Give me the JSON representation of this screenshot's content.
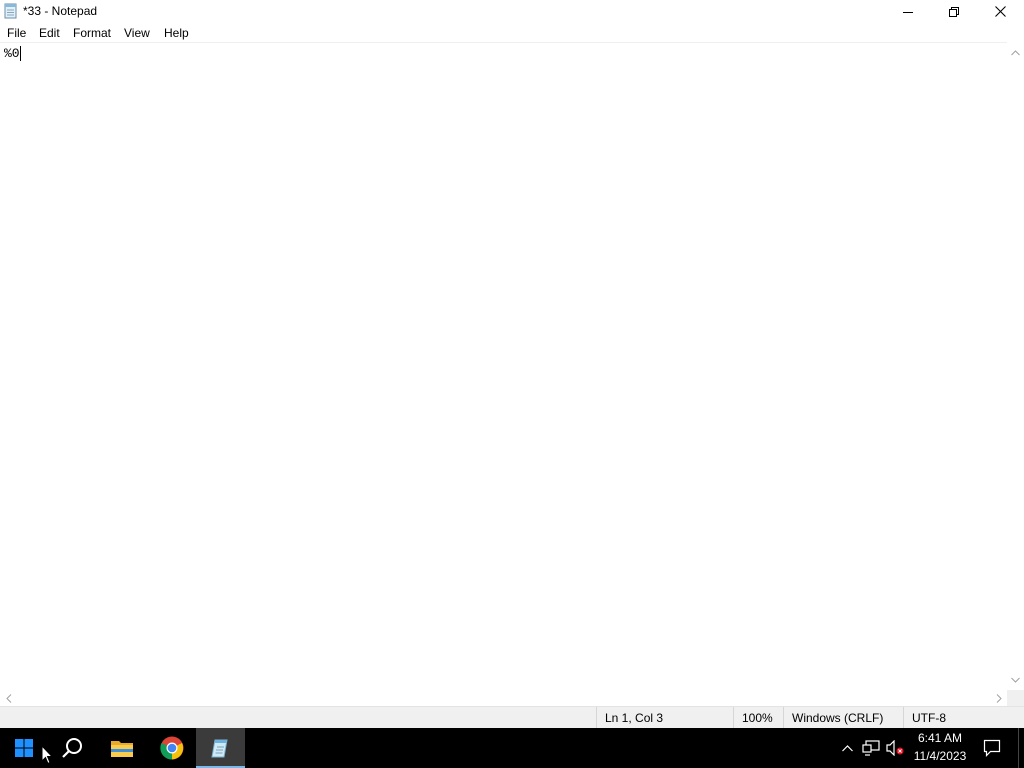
{
  "window": {
    "title": "*33 - Notepad",
    "icon": "notepad-icon"
  },
  "menu": {
    "file": "File",
    "edit": "Edit",
    "format": "Format",
    "view": "View",
    "help": "Help"
  },
  "editor": {
    "content": "%0"
  },
  "status": {
    "position": "Ln 1, Col 3",
    "zoom": "100%",
    "line_ending": "Windows (CRLF)",
    "encoding": "UTF-8"
  },
  "taskbar": {
    "apps": [
      "start-icon",
      "search-icon",
      "file-explorer-icon",
      "chrome-icon",
      "notepad-icon"
    ],
    "active_app": "Notepad",
    "accent": "#76b9ed"
  },
  "clock": {
    "time": "6:41 AM",
    "date": "11/4/2023"
  }
}
